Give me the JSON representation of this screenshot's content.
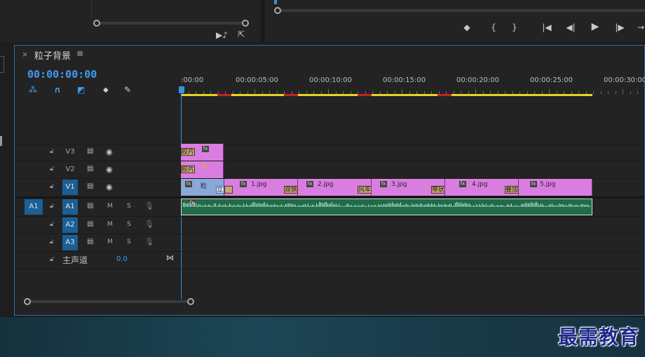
{
  "program_monitor": {
    "controls": [
      "◆",
      "{",
      "}",
      "|◀",
      "◀|",
      "▶",
      "|▶",
      "→"
    ]
  },
  "source_panel": {
    "icons": [
      "▶♪",
      "⇱"
    ]
  },
  "timeline": {
    "sequence_name": "粒子背景",
    "close_label": "×",
    "menu_label": "≡",
    "timecode": "00:00:00:00",
    "ruler_labels": [
      ":00:00",
      "00:00:05:00",
      "00:00:10:00",
      "00:00:15:00",
      "00:00:20:00",
      "00:00:25:00",
      "00:00:30:00"
    ],
    "tracks": [
      {
        "id": "V3",
        "kind": "video"
      },
      {
        "id": "V2",
        "kind": "video"
      },
      {
        "id": "V1",
        "kind": "video",
        "active": true
      },
      {
        "id": "A1",
        "kind": "audio",
        "source": "A1",
        "active": true
      },
      {
        "id": "A2",
        "kind": "audio",
        "active": true
      },
      {
        "id": "A3",
        "kind": "audio",
        "active": true
      }
    ],
    "master": {
      "label": "主声道",
      "value": "0.0"
    },
    "ms_labels": {
      "mute": "M",
      "solo": "S"
    },
    "clips": {
      "v3": {
        "transition": "胶片",
        "fx": "fx"
      },
      "v2": {
        "transition": "胶片",
        "fx": "fx"
      },
      "v1": [
        {
          "name": "粒",
          "transition": "立方"
        },
        {
          "name": "1.jpg",
          "transition": "双侧"
        },
        {
          "name": "2.jpg",
          "transition": "风车"
        },
        {
          "name": "3.jpg",
          "transition": "带状"
        },
        {
          "name": "4.jpg",
          "transition": "叠加"
        },
        {
          "name": "5.jpg"
        }
      ]
    }
  },
  "watermark": "最需教育",
  "colors": {
    "accent": "#3f9cf0",
    "video_clip": "#d97ee0",
    "audio_clip": "#1f6b4a",
    "track_on": "#1b5f95",
    "render_bar": "#e3d623"
  }
}
